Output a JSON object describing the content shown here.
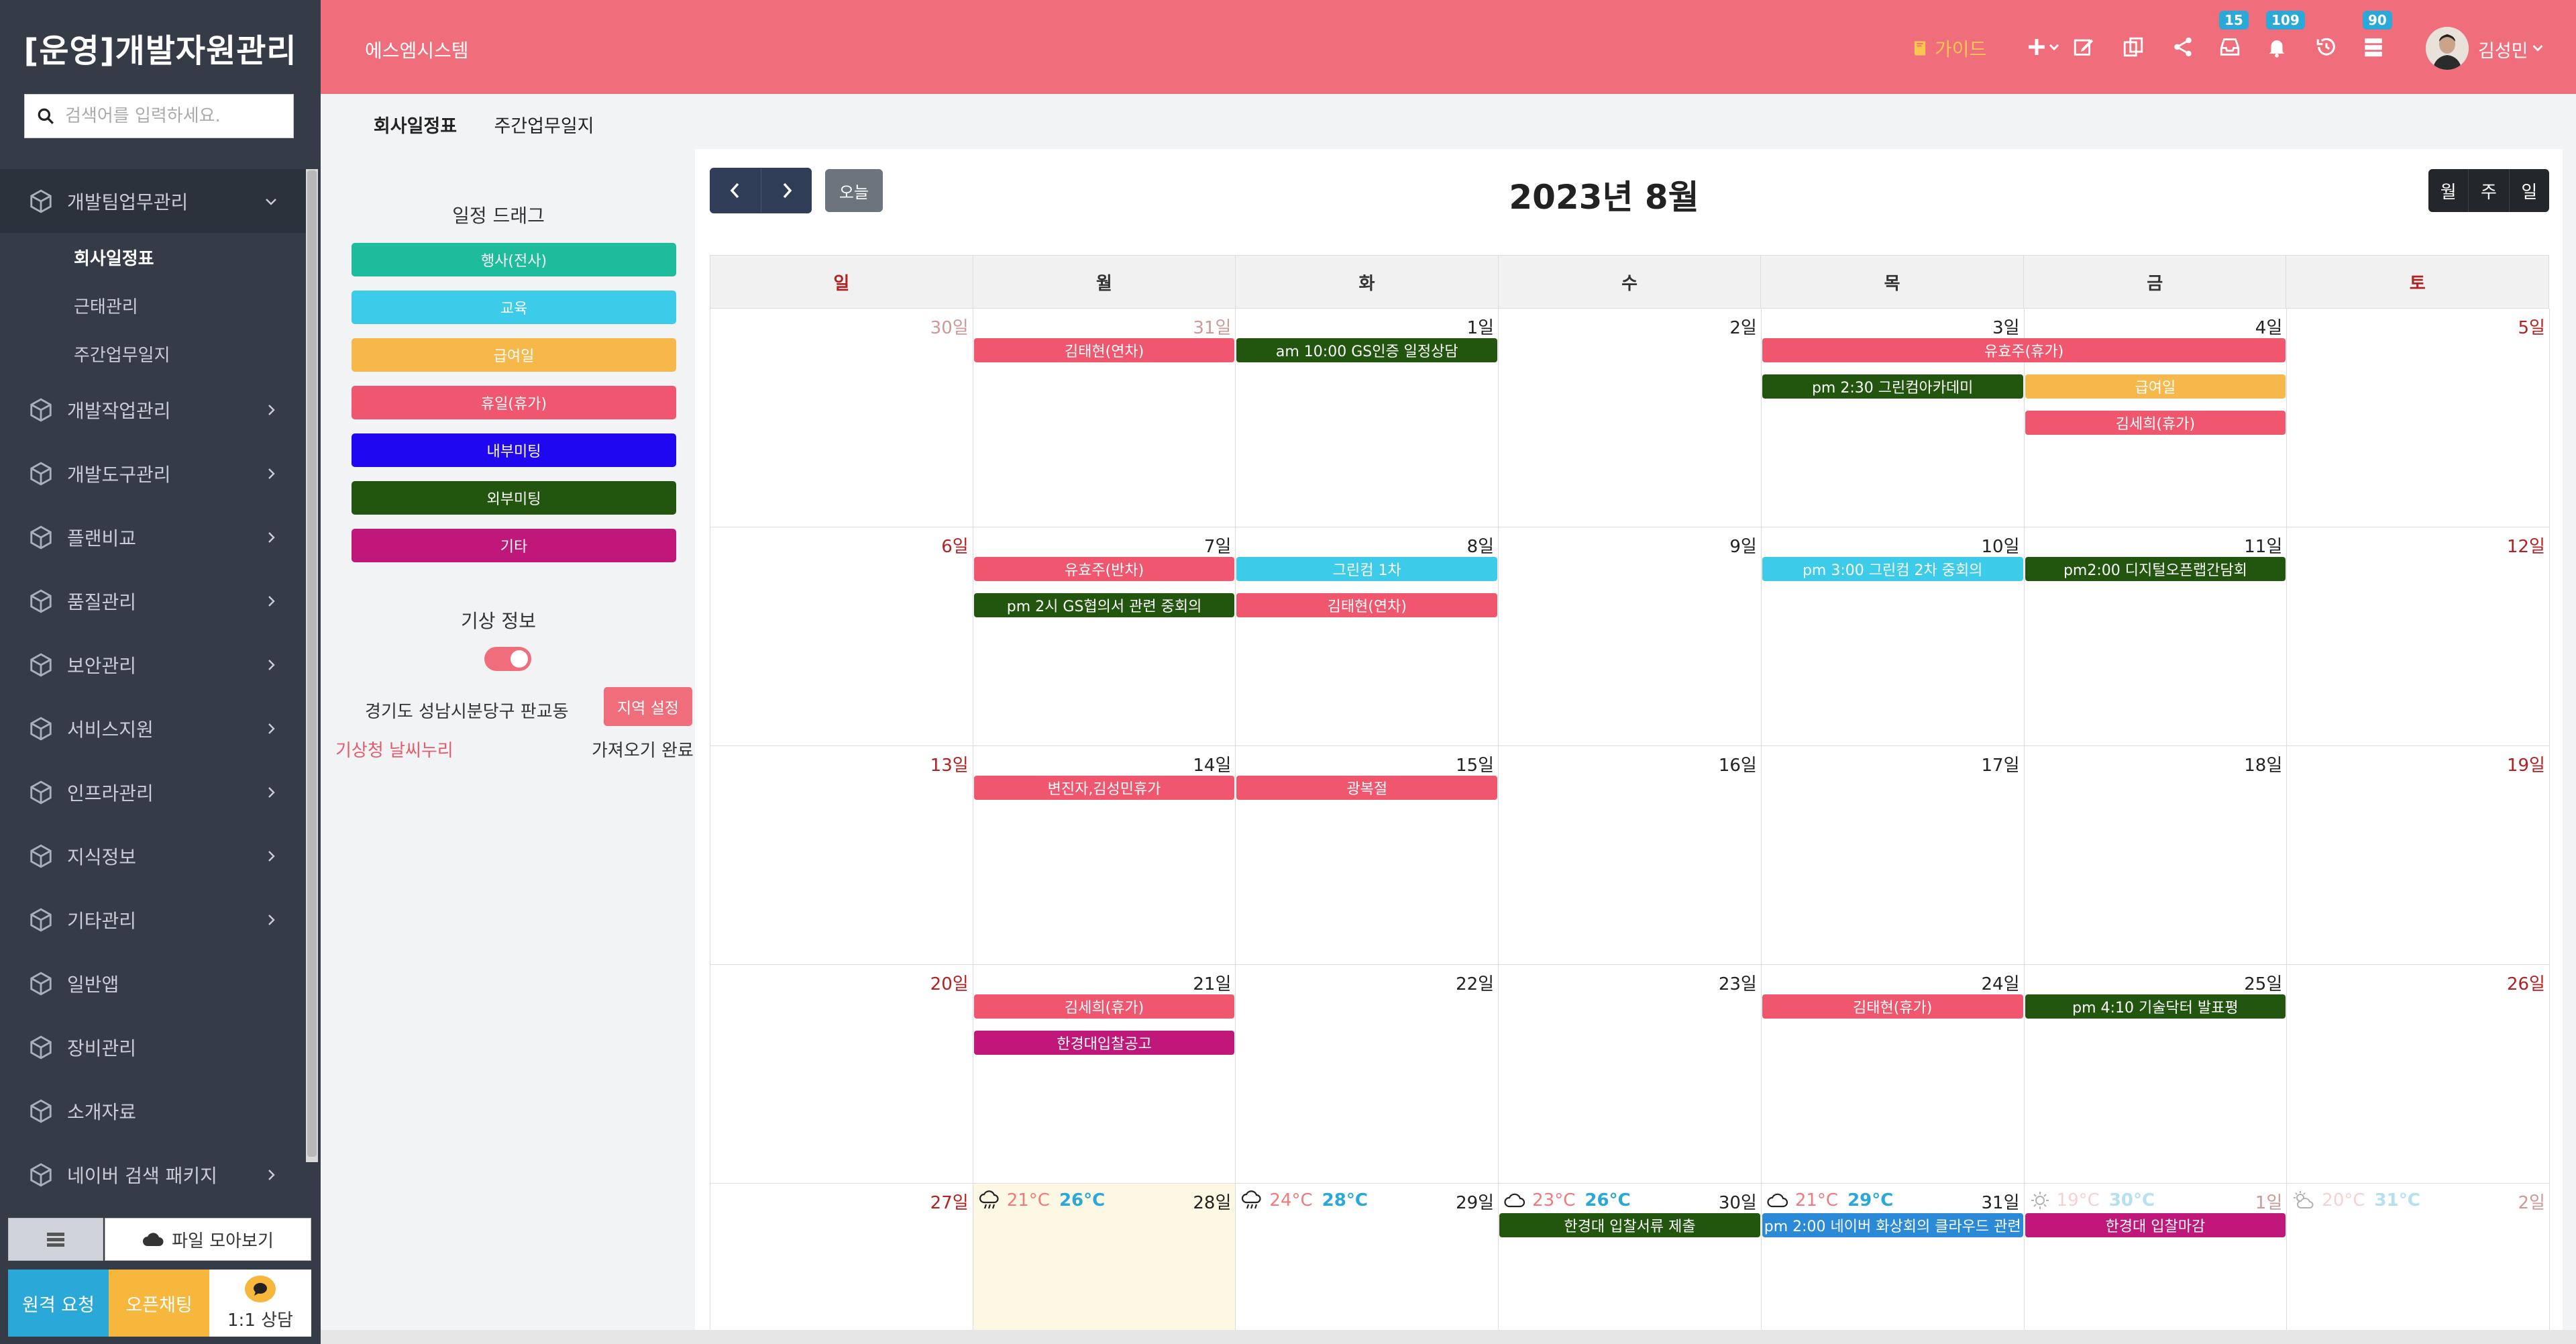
{
  "sidebar": {
    "app_title": "[운영]개발자원관리",
    "search_placeholder": "검색어를 입력하세요.",
    "items": [
      {
        "label": "개발팀업무관리",
        "expanded": true
      },
      {
        "label": "개발작업관리"
      },
      {
        "label": "개발도구관리"
      },
      {
        "label": "플랜비교"
      },
      {
        "label": "품질관리"
      },
      {
        "label": "보안관리"
      },
      {
        "label": "서비스지원"
      },
      {
        "label": "인프라관리"
      },
      {
        "label": "지식정보"
      },
      {
        "label": "기타관리"
      },
      {
        "label": "일반앱"
      },
      {
        "label": "장비관리"
      },
      {
        "label": "소개자료"
      },
      {
        "label": "네이버 검색 패키지"
      }
    ],
    "sub_items": [
      "회사일정표",
      "근태관리",
      "주간업무일지"
    ],
    "bottom": {
      "files_label": "파일 모아보기",
      "remote_label": "원격 요청",
      "chat_label": "오픈채팅",
      "consult_label": "1:1 상담"
    }
  },
  "topbar": {
    "system_name": "에스엠시스템",
    "guide_label": "가이드",
    "badges": {
      "inbox": "15",
      "bell": "109",
      "list": "90"
    },
    "user_name": "김성민"
  },
  "tabs": [
    "회사일정표",
    "주간업무일지"
  ],
  "left_panel": {
    "drag_title": "일정 드래그",
    "categories": [
      {
        "label": "행사(전사)",
        "color": "#1dbc9c"
      },
      {
        "label": "교육",
        "color": "#3ccbe8"
      },
      {
        "label": "급여일",
        "color": "#f6b84a"
      },
      {
        "label": "휴일(휴가)",
        "color": "#f0566e"
      },
      {
        "label": "내부미팅",
        "color": "#1f07f0"
      },
      {
        "label": "외부미팅",
        "color": "#22560f"
      },
      {
        "label": "기타",
        "color": "#c0177a"
      }
    ],
    "weather_title": "기상 정보",
    "region": "경기도 성남시분당구 판교동",
    "region_button": "지역 설정",
    "kma_link": "기상청 날씨누리",
    "fetch_status": "가져오기 완료"
  },
  "calendar": {
    "title": "2023년 8월",
    "today_label": "오늘",
    "views": [
      "월",
      "주",
      "일"
    ],
    "weekdays": [
      "일",
      "월",
      "화",
      "수",
      "목",
      "금",
      "토"
    ],
    "weeks": [
      [
        "30일",
        "31일",
        "1일",
        "2일",
        "3일",
        "4일",
        "5일"
      ],
      [
        "6일",
        "7일",
        "8일",
        "9일",
        "10일",
        "11일",
        "12일"
      ],
      [
        "13일",
        "14일",
        "15일",
        "16일",
        "17일",
        "18일",
        "19일"
      ],
      [
        "20일",
        "21일",
        "22일",
        "23일",
        "24일",
        "25일",
        "26일"
      ],
      [
        "27일",
        "28일",
        "29일",
        "30일",
        "31일",
        "1일",
        "2일"
      ]
    ],
    "weather": [
      {
        "week": 4,
        "day": 1,
        "min": "21°C",
        "max": "26°C",
        "icon": "rain-icon"
      },
      {
        "week": 4,
        "day": 2,
        "min": "24°C",
        "max": "28°C",
        "icon": "rain-icon"
      },
      {
        "week": 4,
        "day": 3,
        "min": "23°C",
        "max": "26°C",
        "icon": "cloud-icon"
      },
      {
        "week": 4,
        "day": 4,
        "min": "21°C",
        "max": "29°C",
        "icon": "cloud-icon"
      },
      {
        "week": 4,
        "day": 5,
        "min": "19°C",
        "max": "30°C",
        "icon": "sun-icon",
        "faded": true
      },
      {
        "week": 4,
        "day": 6,
        "min": "20°C",
        "max": "31°C",
        "icon": "partly-sunny-icon",
        "faded": true
      }
    ],
    "events": [
      {
        "week": 0,
        "start": 1,
        "span": 1,
        "row": 0,
        "label": "김태현(연차)",
        "color": "#f0566e"
      },
      {
        "week": 0,
        "start": 2,
        "span": 1,
        "row": 0,
        "label": "am 10:00 GS인증 일정상담",
        "color": "#22560f"
      },
      {
        "week": 0,
        "start": 4,
        "span": 2,
        "row": 0,
        "label": "유효주(휴가)",
        "color": "#f0566e"
      },
      {
        "week": 0,
        "start": 4,
        "span": 1,
        "row": 1,
        "label": "pm 2:30 그린컴아카데미",
        "color": "#22560f"
      },
      {
        "week": 0,
        "start": 5,
        "span": 1,
        "row": 1,
        "label": "급여일",
        "color": "#f6b84a"
      },
      {
        "week": 0,
        "start": 5,
        "span": 1,
        "row": 2,
        "label": "김세희(휴가)",
        "color": "#f0566e"
      },
      {
        "week": 1,
        "start": 1,
        "span": 1,
        "row": 0,
        "label": "유효주(반차)",
        "color": "#f0566e"
      },
      {
        "week": 1,
        "start": 2,
        "span": 1,
        "row": 0,
        "label": "그린컴 1차",
        "color": "#3ccbe8"
      },
      {
        "week": 1,
        "start": 4,
        "span": 1,
        "row": 0,
        "label": "pm 3:00 그린컴 2차 중회의",
        "color": "#3ccbe8"
      },
      {
        "week": 1,
        "start": 5,
        "span": 1,
        "row": 0,
        "label": "pm2:00 디지털오픈랩간담회",
        "color": "#22560f"
      },
      {
        "week": 1,
        "start": 1,
        "span": 1,
        "row": 1,
        "label": "pm 2시 GS협의서 관련 중회의",
        "color": "#22560f"
      },
      {
        "week": 1,
        "start": 2,
        "span": 1,
        "row": 1,
        "label": "김태현(연차)",
        "color": "#f0566e"
      },
      {
        "week": 2,
        "start": 1,
        "span": 1,
        "row": 0,
        "label": "변진자,김성민휴가",
        "color": "#f0566e"
      },
      {
        "week": 2,
        "start": 2,
        "span": 1,
        "row": 0,
        "label": "광복절",
        "color": "#f0566e"
      },
      {
        "week": 3,
        "start": 1,
        "span": 1,
        "row": 0,
        "label": "김세희(휴가)",
        "color": "#f0566e"
      },
      {
        "week": 3,
        "start": 4,
        "span": 1,
        "row": 0,
        "label": "김태현(휴가)",
        "color": "#f0566e"
      },
      {
        "week": 3,
        "start": 5,
        "span": 1,
        "row": 0,
        "label": "pm 4:10 기술닥터 발표평",
        "color": "#22560f"
      },
      {
        "week": 3,
        "start": 1,
        "span": 1,
        "row": 1,
        "label": "한경대입찰공고",
        "color": "#c0177a"
      },
      {
        "week": 4,
        "start": 3,
        "span": 1,
        "row": 0,
        "label": "한경대 입찰서류 제출",
        "color": "#22560f"
      },
      {
        "week": 4,
        "start": 4,
        "span": 1,
        "row": 0,
        "label": "pm 2:00 네이버 화상회의 클라우드 관련",
        "color": "#2a8ad8"
      },
      {
        "week": 4,
        "start": 5,
        "span": 1,
        "row": 0,
        "label": "한경대 입찰마감",
        "color": "#c0177a"
      }
    ]
  }
}
